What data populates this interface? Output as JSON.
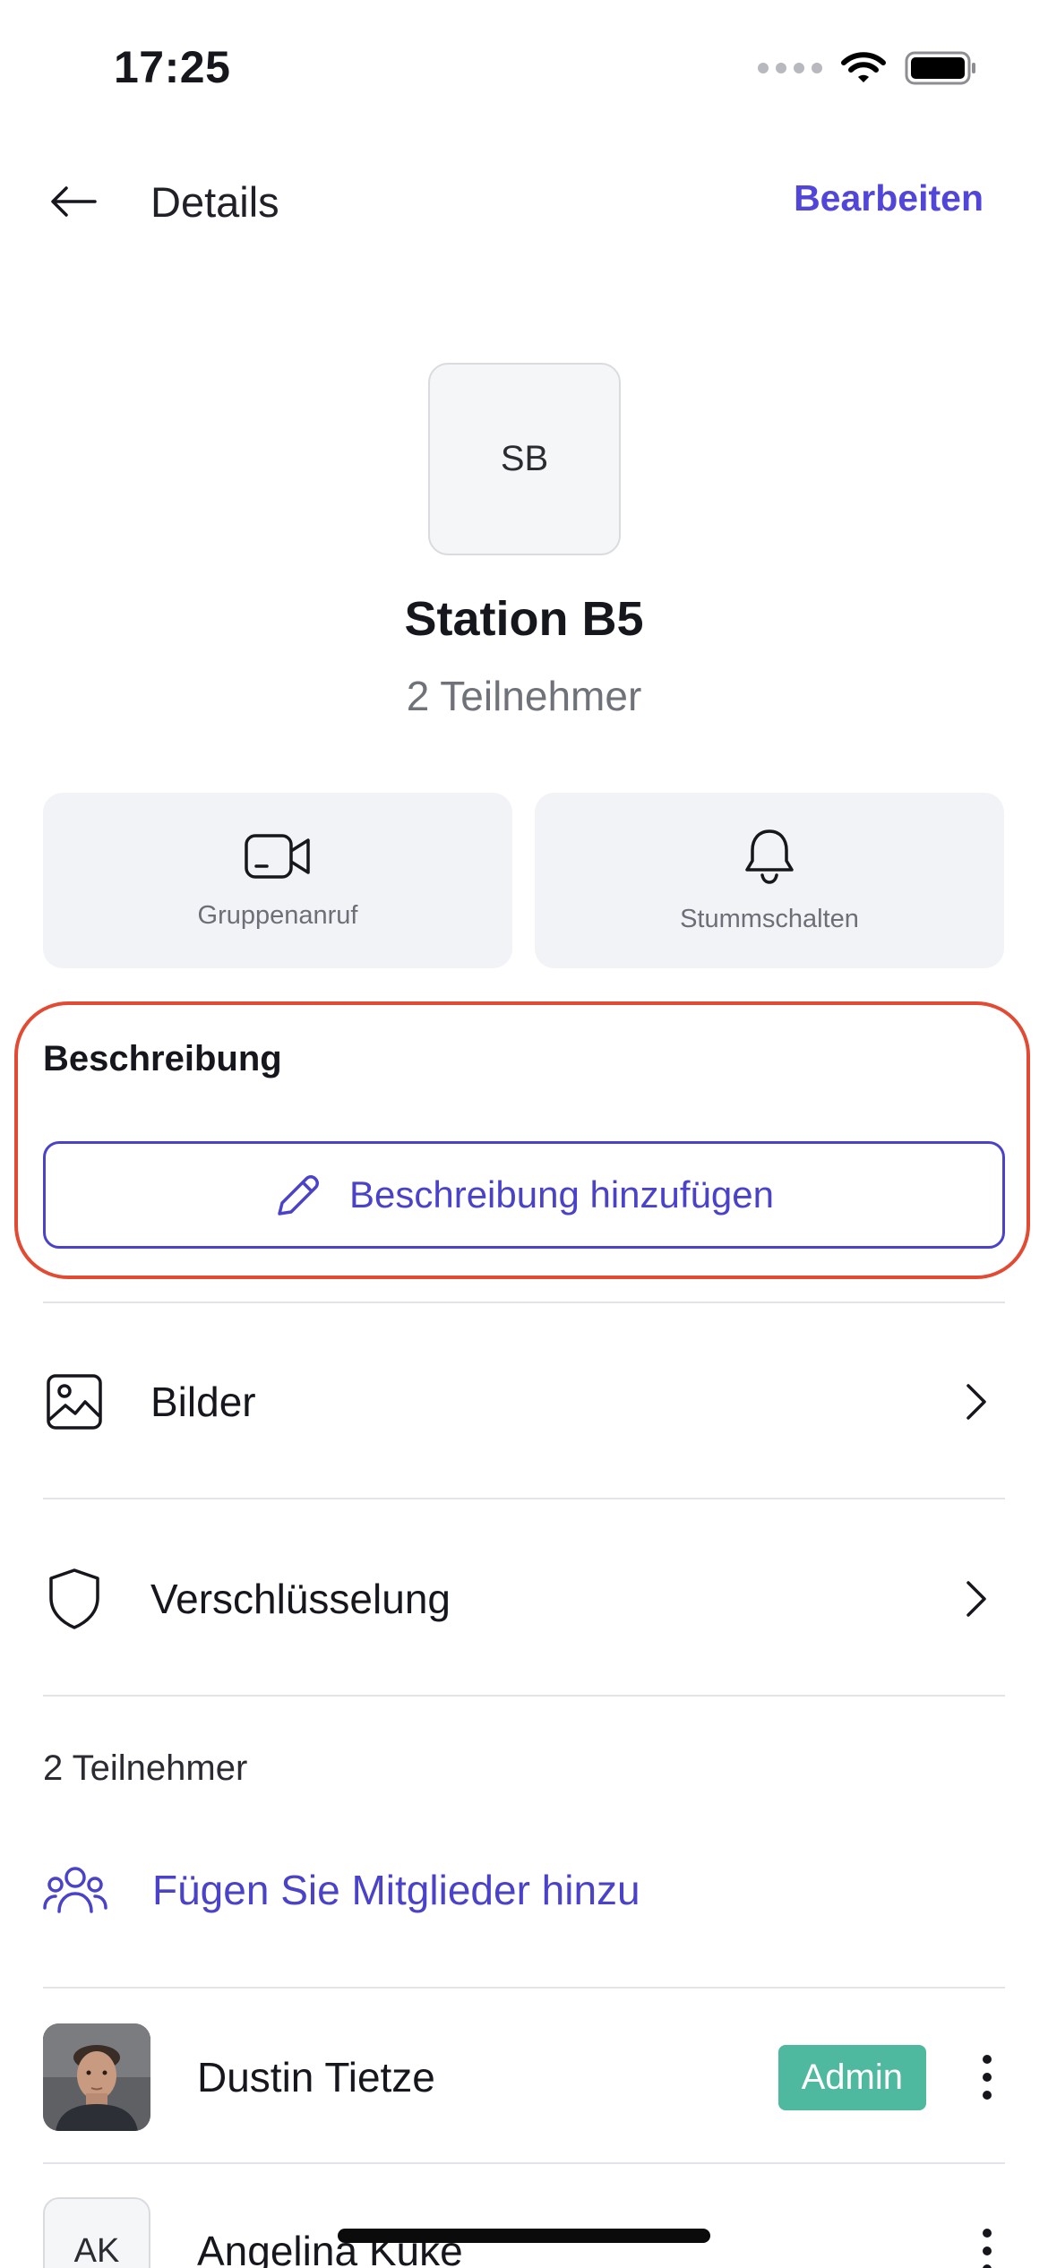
{
  "status_bar": {
    "time": "17:25",
    "icons": [
      "signal-dots-icon",
      "wifi-icon",
      "battery-icon"
    ]
  },
  "header": {
    "back_icon": "arrow-left-icon",
    "title": "Details",
    "edit_label": "Bearbeiten"
  },
  "group": {
    "initials": "SB",
    "name": "Station B5",
    "participants": "2 Teilnehmer"
  },
  "actions": [
    {
      "icon": "video-camera-icon",
      "label": "Gruppenanruf"
    },
    {
      "icon": "bell-icon",
      "label": "Stummschalten"
    }
  ],
  "description": {
    "title": "Beschreibung",
    "add_label": "Beschreibung hinzufügen",
    "add_icon": "pencil-icon"
  },
  "menu": [
    {
      "icon": "image-icon",
      "label": "Bilder"
    },
    {
      "icon": "shield-icon",
      "label": "Verschlüsselung"
    }
  ],
  "members": {
    "heading": "2 Teilnehmer",
    "add_label": "Fügen Sie Mitglieder hinzu",
    "add_icon": "users-icon",
    "list": [
      {
        "name": "Dustin Tietze",
        "badge": "Admin",
        "avatar": "photo"
      },
      {
        "name": "Angelina Kuke",
        "initials": "AK",
        "avatar": "initials"
      }
    ]
  },
  "colors": {
    "accent": "#5146d8",
    "highlight_border": "#e34a33",
    "admin_badge": "#4fb9a0"
  }
}
